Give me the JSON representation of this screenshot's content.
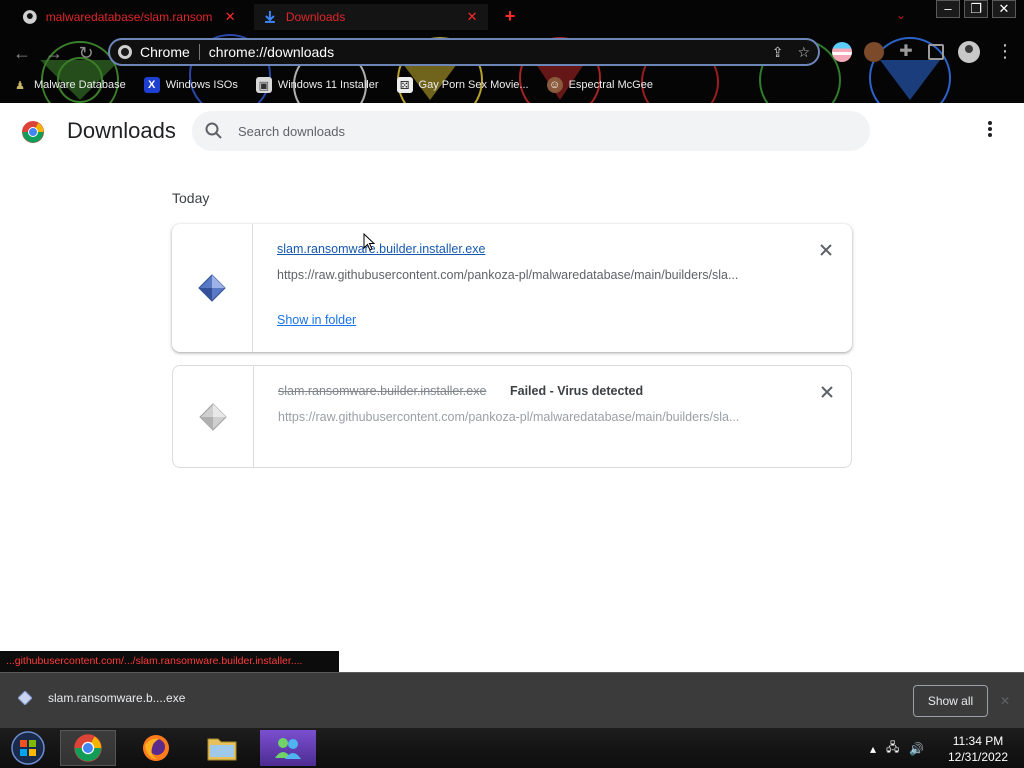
{
  "browser": {
    "tabs": [
      {
        "title": "malwaredatabase/slam.ransomwa",
        "close": "✕"
      },
      {
        "title": "Downloads",
        "close": "✕"
      }
    ],
    "new_tab": "+",
    "tab_search": "⌄",
    "window_buttons": {
      "minimize": "–",
      "restore": "❐",
      "close": "✕"
    },
    "omnibox": {
      "site": "Chrome",
      "url": "chrome://downloads"
    },
    "bookmarks": [
      {
        "label": "Malware Database",
        "icon": "person-icon"
      },
      {
        "label": "Windows ISOs",
        "icon": "x-logo-icon"
      },
      {
        "label": "Windows 11 Installer",
        "icon": "image-icon"
      },
      {
        "label": "Gay Porn Sex Movie...",
        "icon": "dice-icon"
      },
      {
        "label": "Espectral McGee",
        "icon": "avatar-icon"
      }
    ]
  },
  "downloads": {
    "title": "Downloads",
    "search_placeholder": "Search downloads",
    "section": "Today",
    "items": [
      {
        "file_name": "slam.ransomware.builder.installer.exe",
        "url": "https://raw.githubusercontent.com/pankoza-pl/malwaredatabase/main/builders/sla...",
        "action": "Show in folder"
      },
      {
        "file_name": "slam.ransomware.builder.installer.exe",
        "status": "Failed - Virus detected",
        "url": "https://raw.githubusercontent.com/pankoza-pl/malwaredatabase/main/builders/sla..."
      }
    ]
  },
  "status_link": "...githubusercontent.com/.../slam.ransomware.builder.installer....",
  "shelf": {
    "file": "slam.ransomware.b....exe",
    "show_all": "Show all"
  },
  "taskbar": {
    "time": "11:34 PM",
    "date": "12/31/2022"
  },
  "colors": {
    "link": "#1a73e8",
    "chrome_accent": "#e0262a",
    "shelf_bg": "#3b3b3b"
  }
}
